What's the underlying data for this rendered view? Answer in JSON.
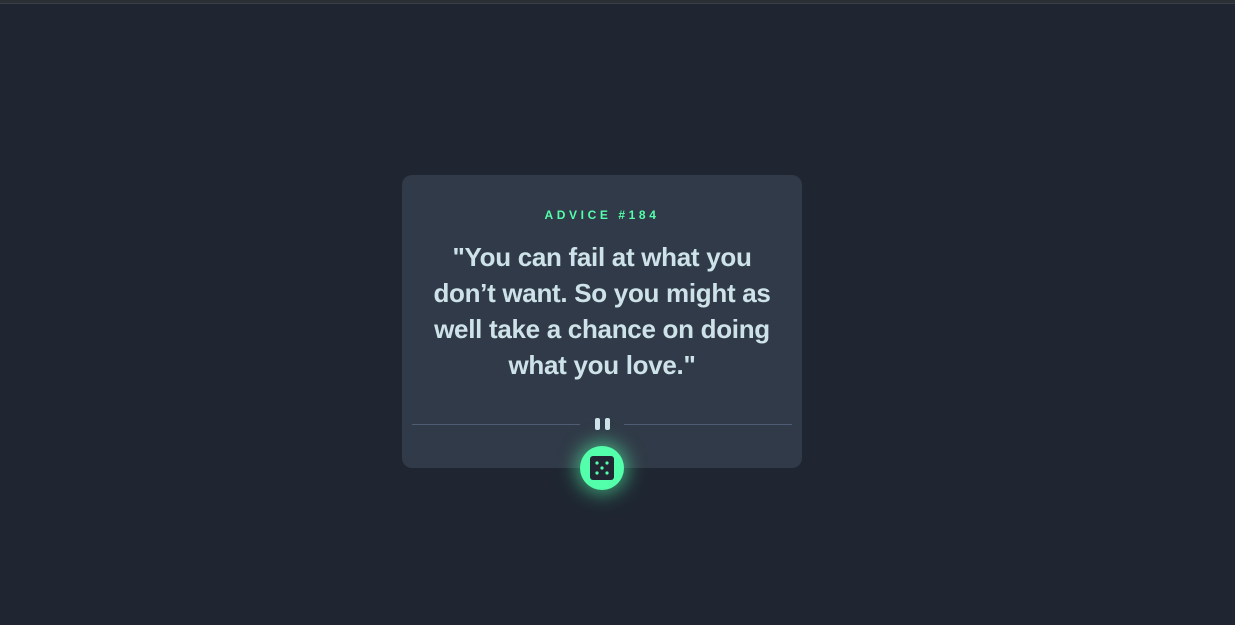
{
  "advice": {
    "label": "ADVICE #184",
    "quote": "\"You can fail at what you don’t want. So you might as well take a chance on doing what you love.\""
  },
  "colors": {
    "background": "#1f2632",
    "card": "#313a48",
    "accent": "#53ffaa",
    "text": "#cee3e9"
  },
  "icons": {
    "divider": "pause-icon",
    "button": "dice-icon"
  }
}
